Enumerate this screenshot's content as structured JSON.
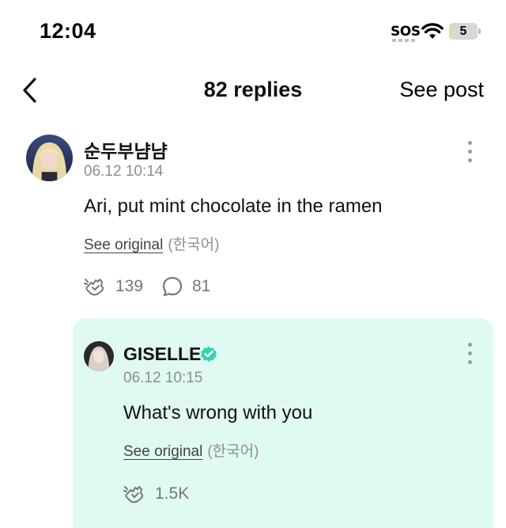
{
  "status_bar": {
    "time": "12:04",
    "sos": "SOS",
    "battery": "5",
    "battery_level_percent": 5,
    "battery_color": "#f3d66b"
  },
  "header": {
    "back_icon": "chevron-left-icon",
    "title": "82 replies",
    "see_post_label": "See post"
  },
  "comment": {
    "username": "순두부냠냠",
    "timestamp": "06.12 10:14",
    "text": "Ari, put mint chocolate in the ramen",
    "see_original_label": "See original",
    "language": "(한국어)",
    "like_icon": "cheer-hand-icon",
    "like_count": "139",
    "reply_icon": "speech-bubble-icon",
    "reply_count": "81"
  },
  "reply": {
    "background_color": "#e0faf1",
    "verified_color": "#2ed3b5",
    "username": "GISELLE",
    "timestamp": "06.12 10:15",
    "text": "What's wrong with you",
    "see_original_label": "See original",
    "language": "(한국어)",
    "like_icon": "cheer-hand-icon",
    "like_count": "1.5K"
  }
}
